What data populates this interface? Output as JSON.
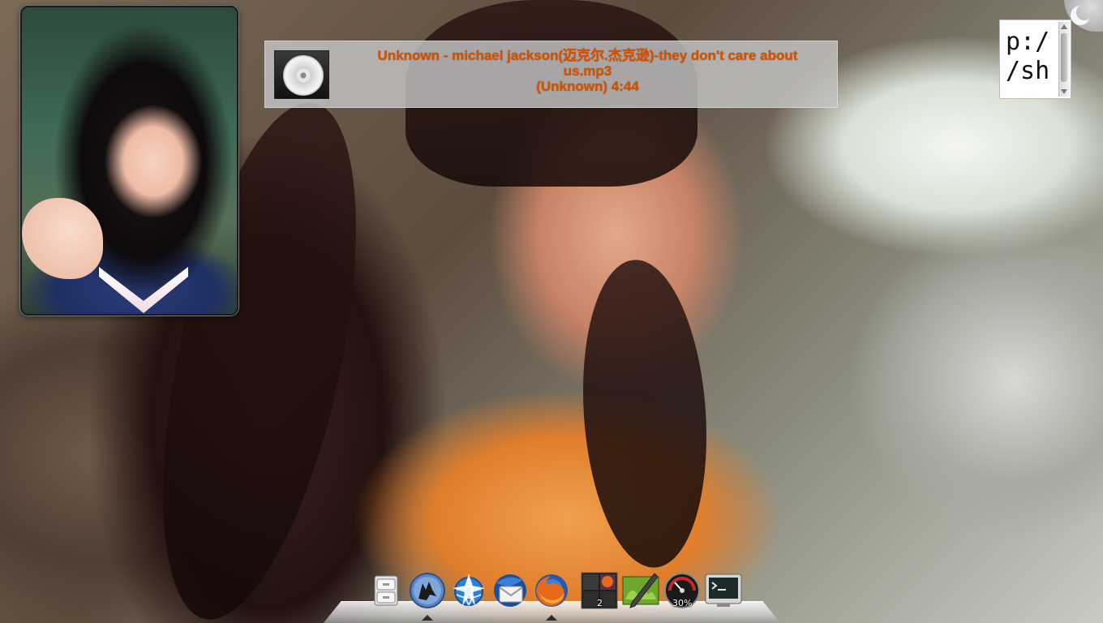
{
  "now_playing": {
    "line1": "Unknown - michael jackson(迈克尔.杰克逊)-they don't care about",
    "line2": "us.mp3",
    "line3": "(Unknown) 4:44",
    "text_color": "#d35400",
    "cover_icon": "cd-icon"
  },
  "terminal": {
    "line1": "p:/",
    "line2": "/sh"
  },
  "dock": {
    "items": [
      {
        "name": "file-manager",
        "icon": "file-cabinet-icon"
      },
      {
        "name": "amarok",
        "icon": "wolf-icon"
      },
      {
        "name": "kde-network",
        "icon": "globe-star-icon"
      },
      {
        "name": "thunderbird",
        "icon": "thunderbird-icon"
      },
      {
        "name": "firefox",
        "icon": "firefox-icon"
      },
      {
        "name": "pager",
        "icon": "pager-icon",
        "badge": "2"
      },
      {
        "name": "image-editor",
        "icon": "image-pen-icon"
      },
      {
        "name": "cpu-meter",
        "icon": "gauge-icon",
        "badge": "30%"
      },
      {
        "name": "terminal",
        "icon": "terminal-icon"
      }
    ]
  }
}
